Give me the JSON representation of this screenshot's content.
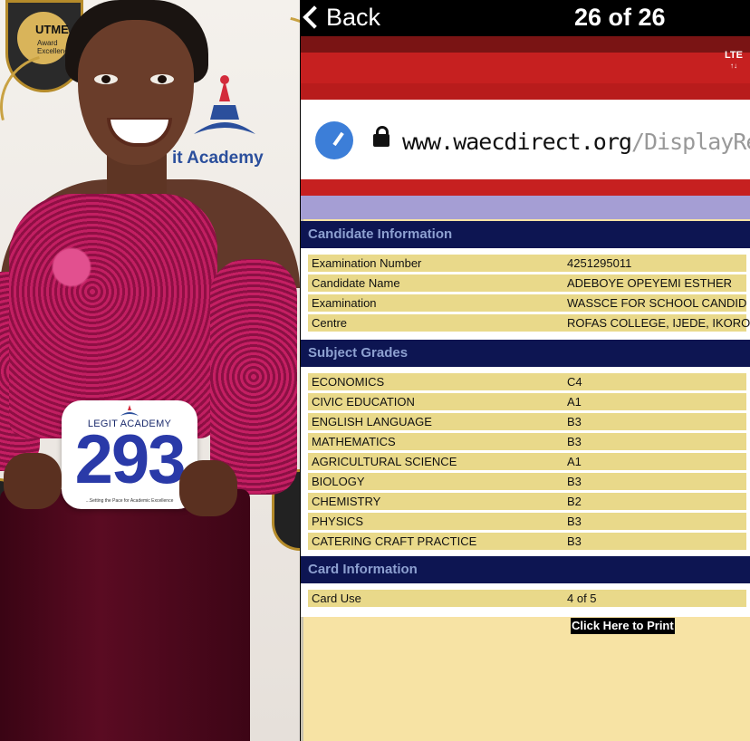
{
  "photo": {
    "backdrop_badge_title": "UTME",
    "backdrop_badge_sub": "Award Excellence",
    "backdrop_academy": "it Academy",
    "bib_title": "LEGIT ACADEMY",
    "bib_number": "293",
    "bib_tagline": "...Setting the Pace for Academic Excellence"
  },
  "nav": {
    "back_label": "Back",
    "counter": "26 of 26",
    "signal": "LTE"
  },
  "browser": {
    "url_main": "www.waecdirect.org",
    "url_rest": "/DisplayRe"
  },
  "candidate": {
    "heading": "Candidate Information",
    "rows": [
      {
        "label": "Examination Number",
        "value": "4251295011"
      },
      {
        "label": "Candidate Name",
        "value": "ADEBOYE OPEYEMI ESTHER"
      },
      {
        "label": "Examination",
        "value": "WASSCE FOR SCHOOL CANDID"
      },
      {
        "label": "Centre",
        "value": "ROFAS COLLEGE, IJEDE, IKORO"
      }
    ]
  },
  "grades": {
    "heading": "Subject Grades",
    "rows": [
      {
        "subject": "ECONOMICS",
        "grade": "C4"
      },
      {
        "subject": "CIVIC EDUCATION",
        "grade": "A1"
      },
      {
        "subject": "ENGLISH LANGUAGE",
        "grade": "B3"
      },
      {
        "subject": "MATHEMATICS",
        "grade": "B3"
      },
      {
        "subject": "AGRICULTURAL SCIENCE",
        "grade": "A1"
      },
      {
        "subject": "BIOLOGY",
        "grade": "B3"
      },
      {
        "subject": "CHEMISTRY",
        "grade": "B2"
      },
      {
        "subject": "PHYSICS",
        "grade": "B3"
      },
      {
        "subject": "CATERING CRAFT PRACTICE",
        "grade": "B3"
      }
    ]
  },
  "card": {
    "heading": "Card Information",
    "rows": [
      {
        "label": "Card Use",
        "value": "4 of 5"
      }
    ]
  },
  "print_label": "Click Here to Print",
  "colors": {
    "section_header": "#0d1552",
    "row_fill": "#e9d98a",
    "page_fill": "#f7e3a4",
    "brand_red": "#c62020"
  }
}
